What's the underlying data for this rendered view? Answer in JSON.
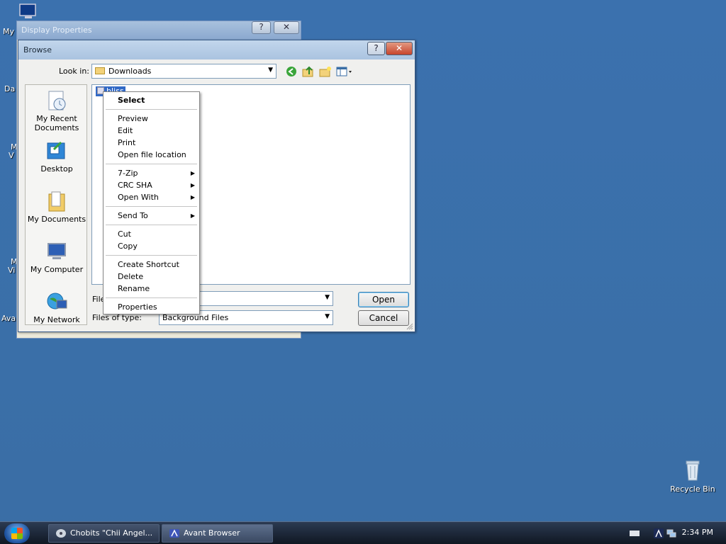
{
  "desktop": {
    "top_left_fragments": [
      "My",
      "Da",
      "M",
      "V",
      "M",
      "Vi",
      "Ava"
    ],
    "recycle_bin": "Recycle Bin"
  },
  "background_window": {
    "title": "Display Properties",
    "help": "?",
    "close": "✕"
  },
  "dialog": {
    "title": "Browse",
    "help": "?",
    "close": "✕",
    "look_in_label": "Look in:",
    "look_in_value": "Downloads",
    "places": [
      "My Recent Documents",
      "Desktop",
      "My Documents",
      "My Computer",
      "My Network"
    ],
    "file_item": "bliss",
    "file_name_label": "File",
    "file_name_value": "",
    "file_type_label": "Files of type:",
    "file_type_value": "Background Files",
    "open_label": "Open",
    "cancel_label": "Cancel"
  },
  "context_menu": {
    "items": [
      {
        "label": "Select",
        "bold": true
      },
      {
        "sep": true
      },
      {
        "label": "Preview"
      },
      {
        "label": "Edit"
      },
      {
        "label": "Print"
      },
      {
        "label": "Open file location"
      },
      {
        "sep": true
      },
      {
        "label": "7-Zip",
        "submenu": true
      },
      {
        "label": "CRC SHA",
        "submenu": true
      },
      {
        "label": "Open With",
        "submenu": true
      },
      {
        "sep": true
      },
      {
        "label": "Send To",
        "submenu": true
      },
      {
        "sep": true
      },
      {
        "label": "Cut"
      },
      {
        "label": "Copy"
      },
      {
        "sep": true
      },
      {
        "label": "Create Shortcut"
      },
      {
        "label": "Delete"
      },
      {
        "label": "Rename"
      },
      {
        "sep": true
      },
      {
        "label": "Properties"
      }
    ]
  },
  "taskbar": {
    "items": [
      "Chobits \"Chii Angel...",
      "Avant Browser"
    ],
    "clock": "2:34 PM"
  }
}
